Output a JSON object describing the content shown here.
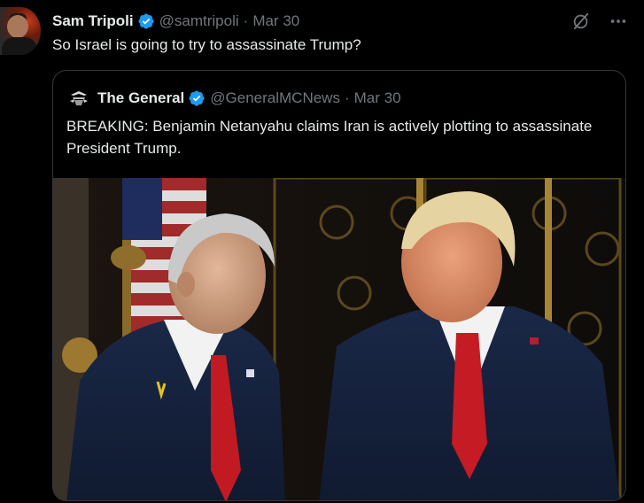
{
  "tweet": {
    "author_name": "Sam Tripoli",
    "author_handle": "@samtripoli",
    "separator": "·",
    "date": "Mar 30",
    "text": "So Israel is going to try to assassinate Trump?"
  },
  "quoted_tweet": {
    "author_name": "The General",
    "author_handle": "@GeneralMCNews",
    "separator": "·",
    "date": "Mar 30",
    "text": "BREAKING: Benjamin Netanyahu claims Iran is actively plotting to assassinate President Trump."
  },
  "icons": {
    "verified": "verified-badge-icon",
    "grok": "grok-icon",
    "more": "more-icon"
  },
  "colors": {
    "background": "#000000",
    "text_primary": "#e7e9ea",
    "text_secondary": "#71767b",
    "verified_blue": "#1d9bf0",
    "border": "#333639"
  }
}
